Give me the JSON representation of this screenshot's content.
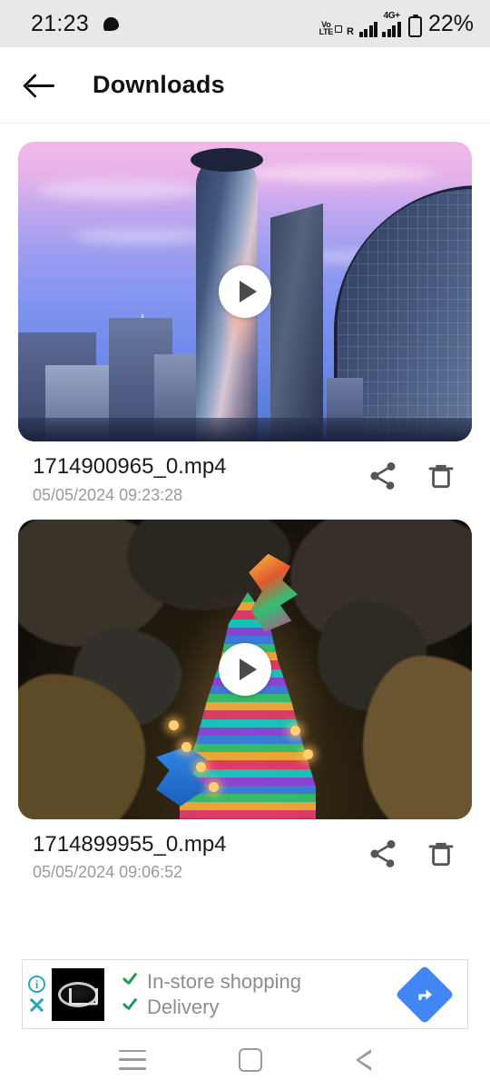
{
  "status_bar": {
    "time": "21:23",
    "notification_icon": "chat-bubble-icon",
    "volte_top": "Vo",
    "volte_bottom": "LTE",
    "roaming": "R",
    "network_type": "4G+",
    "battery_percent": "22%"
  },
  "header": {
    "back_icon": "back-arrow-icon",
    "title": "Downloads"
  },
  "files": [
    {
      "name": "1714900965_0.mp4",
      "date": "05/05/2024 09:23:28",
      "thumbnail_alt": "city-skyline-at-dusk",
      "play_icon": "play-icon",
      "share_icon": "share-icon",
      "delete_icon": "delete-icon"
    },
    {
      "name": "1714899955_0.mp4",
      "date": "05/05/2024 09:06:52",
      "thumbnail_alt": "illuminated-temple-in-cave",
      "play_icon": "play-icon",
      "share_icon": "share-icon",
      "delete_icon": "delete-icon"
    }
  ],
  "ad": {
    "info_label": "i",
    "close_icon": "close-icon",
    "advertiser_logo": "mazda-logo-icon",
    "lines": [
      "In-store shopping",
      "Delivery"
    ],
    "cta_icon": "directions-arrow-icon",
    "accent_color": "#4285f4",
    "check_color": "#1f9b54",
    "badge_color": "#2aa8b8"
  },
  "nav_bar": {
    "recents_icon": "recents-icon",
    "home_icon": "home-icon",
    "back_icon": "back-triangle-icon"
  }
}
